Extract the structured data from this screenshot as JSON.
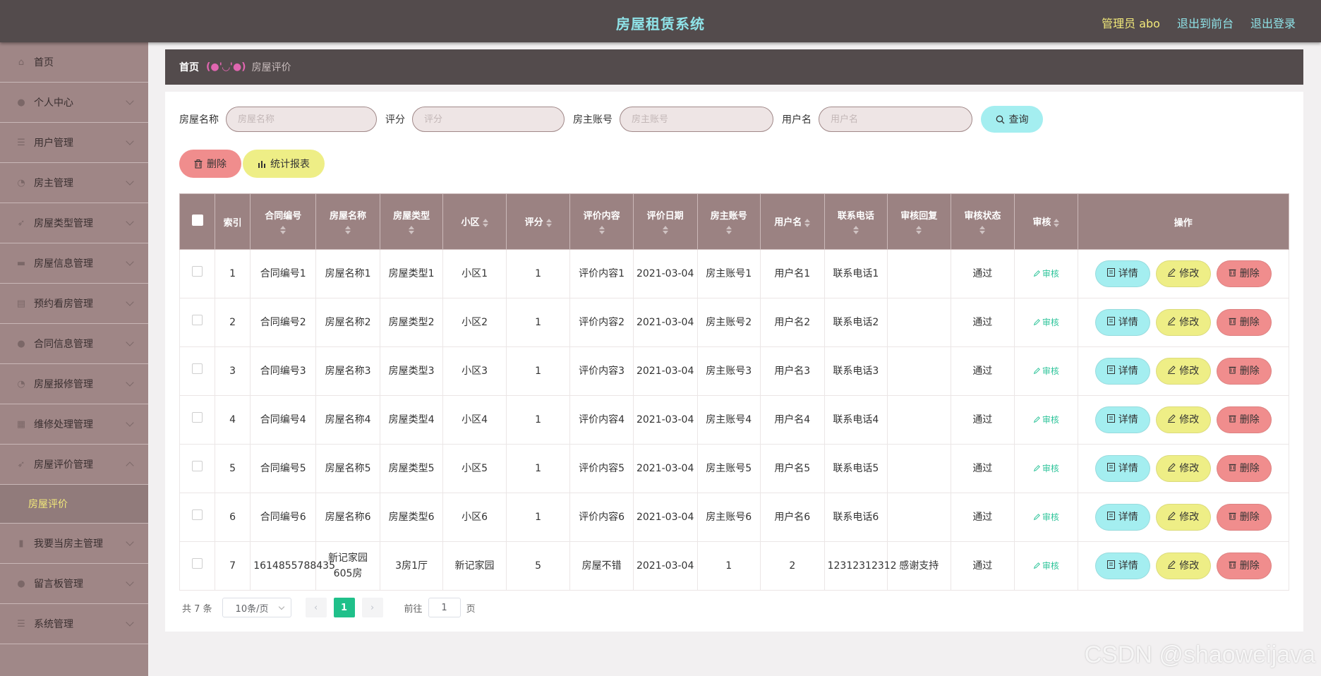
{
  "header": {
    "title": "房屋租赁系统",
    "admin": "管理员 abo",
    "front_link": "退出到前台",
    "logout_link": "退出登录"
  },
  "sidebar": {
    "items": [
      {
        "label": "首页",
        "icon": "home-icon"
      },
      {
        "label": "个人中心",
        "icon": "user-icon"
      },
      {
        "label": "用户管理",
        "icon": "list-icon"
      },
      {
        "label": "房主管理",
        "icon": "clock-icon"
      },
      {
        "label": "房屋类型管理",
        "icon": "pin-icon"
      },
      {
        "label": "房屋信息管理",
        "icon": "monitor-icon"
      },
      {
        "label": "预约看房管理",
        "icon": "doc-icon"
      },
      {
        "label": "合同信息管理",
        "icon": "user-icon"
      },
      {
        "label": "房屋报修管理",
        "icon": "clock-icon"
      },
      {
        "label": "维修处理管理",
        "icon": "grid-icon"
      },
      {
        "label": "房屋评价管理",
        "icon": "pin-icon"
      },
      {
        "label": "我要当房主管理",
        "icon": "chart-icon"
      },
      {
        "label": "留言板管理",
        "icon": "user-icon"
      },
      {
        "label": "系统管理",
        "icon": "list-icon"
      }
    ],
    "active_sub": "房屋评价"
  },
  "breadcrumb": {
    "home": "首页",
    "face": "(●'◡'●)",
    "current": "房屋评价"
  },
  "search": {
    "house_name_label": "房屋名称",
    "house_name_placeholder": "房屋名称",
    "score_label": "评分",
    "score_placeholder": "评分",
    "owner_label": "房主账号",
    "owner_placeholder": "房主账号",
    "user_label": "用户名",
    "user_placeholder": "用户名",
    "query_button": "查询"
  },
  "actions": {
    "delete": "删除",
    "report": "统计报表"
  },
  "table": {
    "headers": {
      "index": "索引",
      "contract": "合同编号",
      "house_name": "房屋名称",
      "house_type": "房屋类型",
      "community": "小区",
      "score": "评分",
      "content": "评价内容",
      "date": "评价日期",
      "owner": "房主账号",
      "user": "用户名",
      "phone": "联系电话",
      "reply": "审核回复",
      "status": "审核状态",
      "review": "审核",
      "ops": "操作"
    },
    "row_buttons": {
      "review": "审核",
      "detail": "详情",
      "edit": "修改",
      "delete": "删除"
    },
    "rows": [
      {
        "index": "1",
        "contract": "合同编号1",
        "house_name": "房屋名称1",
        "house_type": "房屋类型1",
        "community": "小区1",
        "score": "1",
        "content": "评价内容1",
        "date": "2021-03-04",
        "owner": "房主账号1",
        "user": "用户名1",
        "phone": "联系电话1",
        "reply": "",
        "status": "通过"
      },
      {
        "index": "2",
        "contract": "合同编号2",
        "house_name": "房屋名称2",
        "house_type": "房屋类型2",
        "community": "小区2",
        "score": "1",
        "content": "评价内容2",
        "date": "2021-03-04",
        "owner": "房主账号2",
        "user": "用户名2",
        "phone": "联系电话2",
        "reply": "",
        "status": "通过"
      },
      {
        "index": "3",
        "contract": "合同编号3",
        "house_name": "房屋名称3",
        "house_type": "房屋类型3",
        "community": "小区3",
        "score": "1",
        "content": "评价内容3",
        "date": "2021-03-04",
        "owner": "房主账号3",
        "user": "用户名3",
        "phone": "联系电话3",
        "reply": "",
        "status": "通过"
      },
      {
        "index": "4",
        "contract": "合同编号4",
        "house_name": "房屋名称4",
        "house_type": "房屋类型4",
        "community": "小区4",
        "score": "1",
        "content": "评价内容4",
        "date": "2021-03-04",
        "owner": "房主账号4",
        "user": "用户名4",
        "phone": "联系电话4",
        "reply": "",
        "status": "通过"
      },
      {
        "index": "5",
        "contract": "合同编号5",
        "house_name": "房屋名称5",
        "house_type": "房屋类型5",
        "community": "小区5",
        "score": "1",
        "content": "评价内容5",
        "date": "2021-03-04",
        "owner": "房主账号5",
        "user": "用户名5",
        "phone": "联系电话5",
        "reply": "",
        "status": "通过"
      },
      {
        "index": "6",
        "contract": "合同编号6",
        "house_name": "房屋名称6",
        "house_type": "房屋类型6",
        "community": "小区6",
        "score": "1",
        "content": "评价内容6",
        "date": "2021-03-04",
        "owner": "房主账号6",
        "user": "用户名6",
        "phone": "联系电话6",
        "reply": "",
        "status": "通过"
      },
      {
        "index": "7",
        "contract": "1614855788435",
        "house_name": "新记家园605房",
        "house_type": "3房1厅",
        "community": "新记家园",
        "score": "5",
        "content": "房屋不错",
        "date": "2021-03-04",
        "owner": "1",
        "user": "2",
        "phone": "12312312312",
        "reply": "感谢支持",
        "status": "通过"
      }
    ]
  },
  "pager": {
    "total": "共 7 条",
    "page_size": "10条/页",
    "prev": "‹",
    "current": "1",
    "next": "›",
    "goto": "前往",
    "goto_value": "1",
    "unit": "页"
  },
  "watermark": "CSDN @shaoweijava",
  "colors": {
    "topbar": "#534b4c",
    "title": "#8fe3e8",
    "admin": "#f2e97a",
    "sidebar": "#a08888",
    "table_header": "#9b8282",
    "cyan_button": "#a4eef0",
    "yellow_button": "#eeee86",
    "red_button": "#f08d8d",
    "pager_active": "#20c08a"
  }
}
